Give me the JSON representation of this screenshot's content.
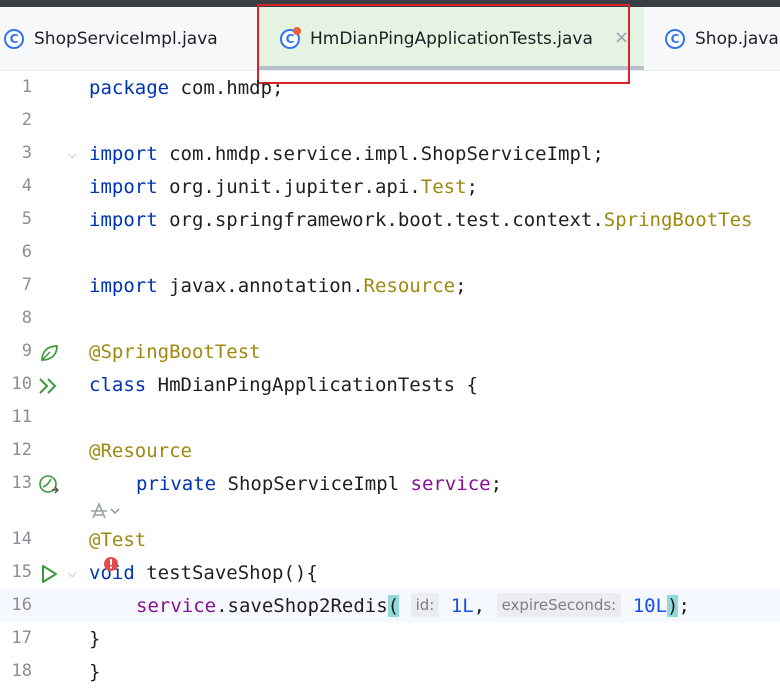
{
  "tabs": [
    {
      "label": "ShopServiceImpl.java",
      "icon": "class-icon"
    },
    {
      "label": "HmDianPingApplicationTests.java",
      "icon": "class-run-icon",
      "active": true
    },
    {
      "label": "Shop.java",
      "icon": "class-icon"
    }
  ],
  "tab_close_glyph": "×",
  "class_glyph": "C",
  "line_numbers": [
    "1",
    "2",
    "3",
    "4",
    "5",
    "6",
    "7",
    "8",
    "9",
    "10",
    "11",
    "12",
    "13",
    "14",
    "15",
    "16",
    "17",
    "18"
  ],
  "code": {
    "l1_kw": "package",
    "l1_rest": " com.hmdp;",
    "l3_kw": "import",
    "l3_rest": " com.hmdp.service.impl.ShopServiceImpl;",
    "l4_kw": "import",
    "l4_pre": " org.junit.jupiter.api.",
    "l4_ann": "Test",
    "l4_post": ";",
    "l5_kw": "import",
    "l5_pre": " org.springframework.boot.test.context.",
    "l5_ann": "SpringBootTes",
    "l7_kw": "import",
    "l7_pre": " javax.annotation.",
    "l7_ann": "Resource",
    "l7_post": ";",
    "l9_ann": "@SpringBootTest",
    "l10_kw": "class",
    "l10_rest": " HmDianPingApplicationTests {",
    "l12_ann": "@Resource",
    "l13_kw": "private",
    "l13_mid": " ShopServiceImpl ",
    "l13_fld": "service",
    "l13_post": ";",
    "l14_ann": "@Test",
    "l15_kw": "void",
    "l15_rest": " testSaveShop(){",
    "l16_fld": "service",
    "l16_mid": ".saveShop2Redis",
    "l16_open": "(",
    "l16_hint1": "id:",
    "l16_num1": "1L",
    "l16_comma": ", ",
    "l16_hint2": "expireSeconds:",
    "l16_num2": "10L",
    "l16_close": ")",
    "l16_semi": ";",
    "l17": "}",
    "l18": "}"
  },
  "colors": {
    "keyword": "#0033b3",
    "annotation": "#9e880d",
    "field": "#871094",
    "number": "#1750eb",
    "active_tab": "#e4f3e2",
    "highlight_box": "#d9242a"
  }
}
